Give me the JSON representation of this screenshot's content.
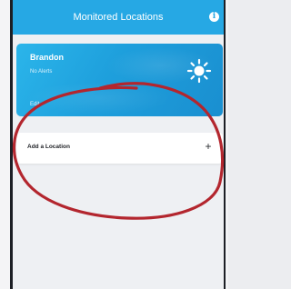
{
  "header": {
    "title": "Monitored Locations",
    "info_icon": "i"
  },
  "locations": [
    {
      "name": "Brandon",
      "status": "No Alerts",
      "edit_label": "Edit",
      "weather_icon": "sun-icon"
    }
  ],
  "add_location": {
    "label": "Add a Location",
    "icon": "+"
  },
  "colors": {
    "header": "#26a8e4",
    "card": "#1e9fdc",
    "annotation": "#b3262e"
  }
}
